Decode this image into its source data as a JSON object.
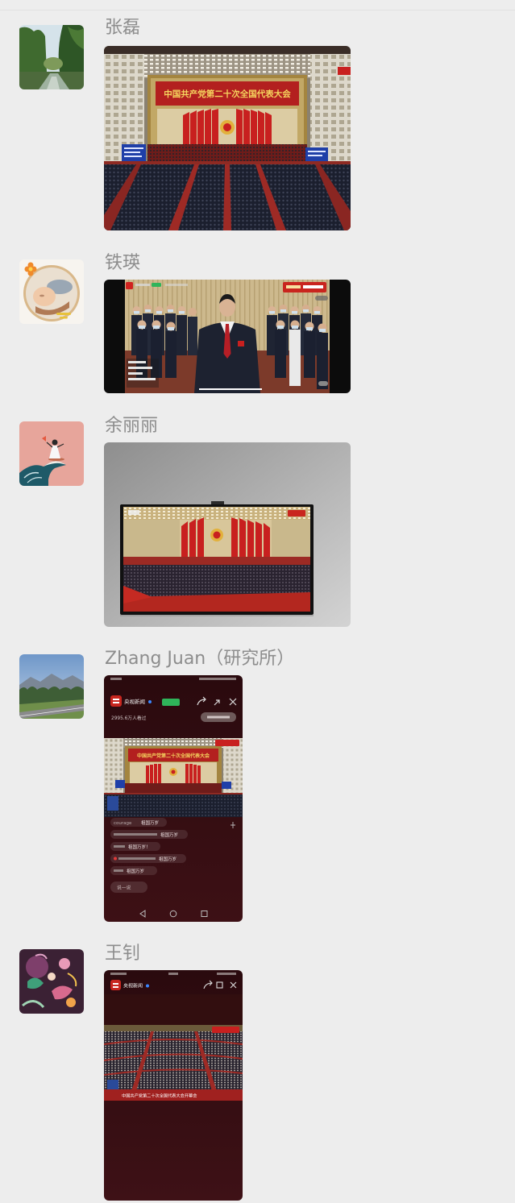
{
  "page": {
    "background": "#ededed",
    "name_color": "#8d8d8d"
  },
  "messages": [
    {
      "sender": "张磊",
      "avatar_icon": "river-landscape-avatar",
      "image": {
        "banner": "中国共产党第二十次全国代表大会"
      }
    },
    {
      "sender": "铁瑛",
      "avatar_icon": "baby-photo-avatar",
      "image": {}
    },
    {
      "sender": "余丽丽",
      "avatar_icon": "wave-girl-illustration-avatar",
      "image": {}
    },
    {
      "sender": "Zhang Juan（研究所）",
      "avatar_icon": "mountain-road-avatar",
      "image": {
        "channel": "央视新闻",
        "viewers": "2995.6万人看过",
        "banner": "中国共产党第二十次全国代表大会",
        "comments": [
          {
            "user": "courage",
            "text": "祖国万岁"
          },
          {
            "user": "",
            "text": "祖国万岁"
          },
          {
            "user": "",
            "text": "祖国万岁！"
          },
          {
            "user": "",
            "text": "祖国万岁"
          },
          {
            "user": "",
            "text": "祖国万岁"
          }
        ],
        "input_placeholder": "说一说"
      }
    },
    {
      "sender": "王钊",
      "avatar_icon": "floral-illustration-avatar",
      "image": {
        "channel": "央视新闻",
        "caption": "中国共产党第二十次全国代表大会开幕会"
      }
    }
  ]
}
